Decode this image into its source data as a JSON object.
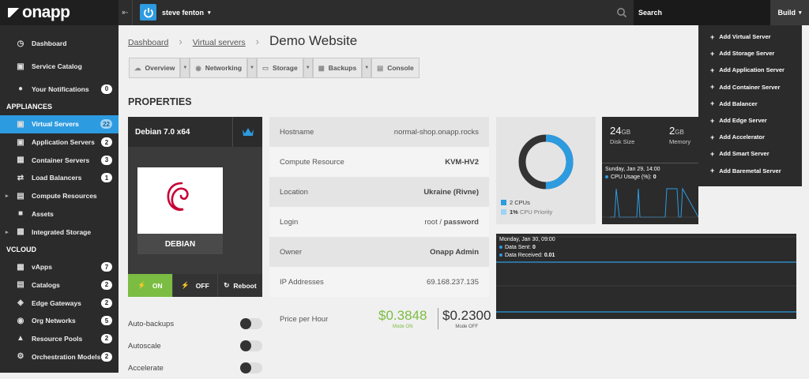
{
  "app": {
    "logo": "onapp"
  },
  "sidebar": {
    "main": [
      {
        "label": "Dashboard",
        "icon": "dashboard-icon"
      },
      {
        "label": "Service Catalog",
        "icon": "catalog-icon"
      },
      {
        "label": "Your Notifications",
        "icon": "bell-icon",
        "count": "0"
      }
    ],
    "appliances_title": "APPLIANCES",
    "appliances": [
      {
        "label": "Virtual Servers",
        "count": "22",
        "active": true
      },
      {
        "label": "Application Servers",
        "count": "2"
      },
      {
        "label": "Container Servers",
        "count": "3"
      },
      {
        "label": "Load Balancers",
        "count": "1"
      },
      {
        "label": "Compute Resources"
      },
      {
        "label": "Assets"
      },
      {
        "label": "Integrated Storage"
      }
    ],
    "vcloud_title": "VCLOUD",
    "vcloud": [
      {
        "label": "vApps",
        "count": "7"
      },
      {
        "label": "Catalogs",
        "count": "2"
      },
      {
        "label": "Edge Gateways",
        "count": "2"
      },
      {
        "label": "Org Networks",
        "count": "5"
      },
      {
        "label": "Resource Pools",
        "count": "2"
      },
      {
        "label": "Orchestration Models",
        "count": "2"
      }
    ]
  },
  "topbar": {
    "user": "steve fenton",
    "search": "Search",
    "build": "Build"
  },
  "breadcrumb": {
    "home": "Dashboard",
    "section": "Virtual servers",
    "title": "Demo Website"
  },
  "tabs": [
    "Overview",
    "Networking",
    "Storage",
    "Backups",
    "Console"
  ],
  "properties_title": "PROPERTIES",
  "vm": {
    "name": "Debian 7.0 x64",
    "os": "DEBIAN",
    "on": "ON",
    "off": "OFF",
    "reboot": "Reboot"
  },
  "toggles": [
    "Auto-backups",
    "Autoscale",
    "Accelerate"
  ],
  "info": [
    {
      "label": "Hostname",
      "value": "normal-shop.onapp.rocks",
      "bold": false
    },
    {
      "label": "Compute Resource",
      "value": "KVM-HV2",
      "bold": true
    },
    {
      "label": "Location",
      "value": "Ukraine (Rivne)",
      "bold": true
    },
    {
      "label": "Login",
      "value": "root",
      "value_pw": "password"
    },
    {
      "label": "Owner",
      "value": "Onapp Admin",
      "bold": true
    },
    {
      "label": "IP Addresses",
      "value": "69.168.237.135",
      "bold": false
    }
  ],
  "price": {
    "label": "Price per Hour",
    "on_value": "$0.3848",
    "on_label": "Mode ON",
    "off_value": "$0.2300",
    "off_label": "Mode OFF"
  },
  "cpu": {
    "cpus": "2 CPUs",
    "priority": "1% CPU Priority",
    "priority_pct": "1%",
    "priority_text": "CPU Priority",
    "usage_fraction": 0.5,
    "colors": {
      "cpu": "#2d9be0",
      "rest": "#333333",
      "priority": "#9fd3f5"
    }
  },
  "resources": {
    "disk_value": "24",
    "disk_unit": "GB",
    "disk_label": "Disk Size",
    "mem_value": "2",
    "mem_unit": "GB",
    "mem_label": "Memory",
    "cpu_graph": {
      "time": "Sunday, Jan 29, 14:00",
      "series": "CPU Usage (%):",
      "value": "0"
    }
  },
  "network": {
    "time": "Monday, Jan 30, 09:00",
    "sent_label": "Data Sent:",
    "sent": "0",
    "recv_label": "Data Received:",
    "recv": "0.01"
  },
  "build_menu": [
    "Add Virtual Server",
    "Add Storage Server",
    "Add Application Server",
    "Add Container Server",
    "Add Balancer",
    "Add Edge Server",
    "Add Accelerator",
    "Add Smart Server",
    "Add Baremetal Server"
  ],
  "colors": {
    "accent": "#2d9be0",
    "green": "#7bbd42",
    "dark": "#2b2b2b"
  }
}
